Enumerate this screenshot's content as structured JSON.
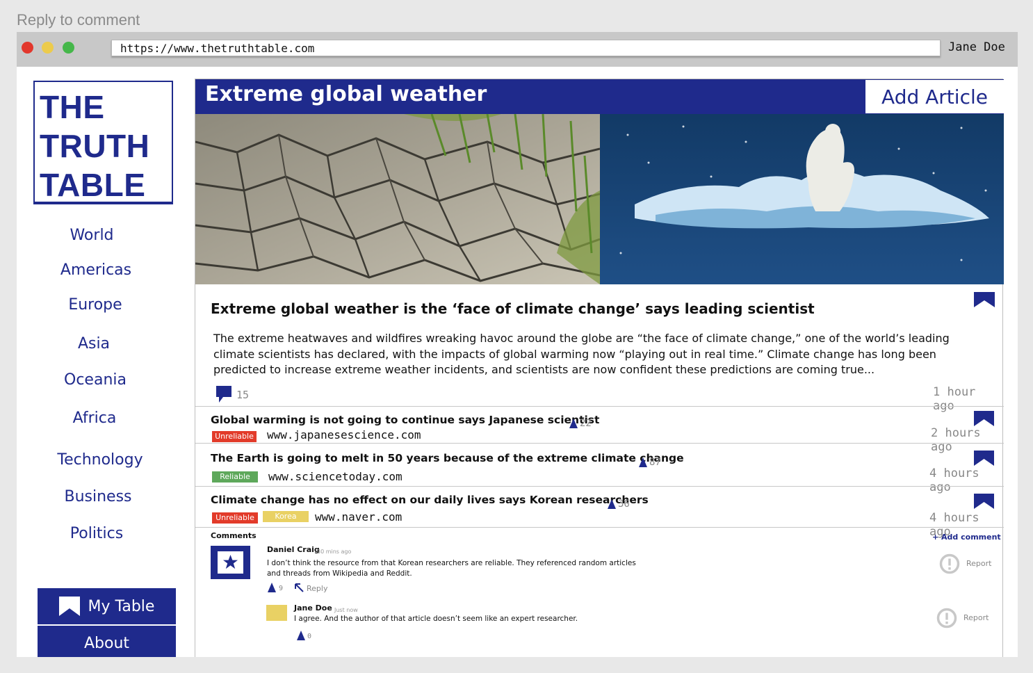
{
  "caption": "Reply to comment",
  "browser": {
    "url": "https://www.thetruthtable.com",
    "user": "Jane Doe"
  },
  "logo": {
    "line1": "THE",
    "line2": "TRUTH",
    "line3": "TABLE"
  },
  "nav": [
    "World",
    "Americas",
    "Europe",
    "Asia",
    "Oceania",
    "Africa",
    "Technology",
    "Business",
    "Politics"
  ],
  "sidebar_buttons": {
    "my_table": "My Table",
    "about": "About"
  },
  "header": {
    "title": "Extreme global weather",
    "add_article": "Add Article"
  },
  "main_article": {
    "title": "Extreme global weather is the ‘face of climate change’ says leading scientist",
    "body": "The extreme heatwaves and wildfires wreaking havoc around the globe are “the face of climate change,” one of the world’s leading climate scientists has declared, with the impacts of global warming now “playing out in real time.” Climate change has long been predicted to increase extreme weather incidents, and scientists are now confident these predictions are coming true...",
    "comment_count": "15",
    "time": "1 hour ago"
  },
  "related": [
    {
      "title": "Global warming is not going to continue says Japanese scientist",
      "badges": [
        "Unreliable"
      ],
      "source": "www.japanesescience.com",
      "votes": "22",
      "time": "2 hours ago"
    },
    {
      "title": "The Earth is going to melt in 50 years because of the extreme climate change",
      "badges": [
        "Reliable"
      ],
      "source": "www.sciencetoday.com",
      "votes": "87",
      "time": "4 hours ago"
    },
    {
      "title": "Climate change has no effect on our daily lives says Korean researchers",
      "badges": [
        "Unreliable",
        "Korea"
      ],
      "source": "www.naver.com",
      "votes": "36",
      "time": "4 hours ago"
    }
  ],
  "comments": {
    "label": "Comments",
    "add_label": "+ Add comment",
    "items": [
      {
        "author": "Daniel Craig",
        "time": "30 mins ago",
        "text_line1": "I don’t think the resource from that Korean researchers are reliable. They referenced random articles",
        "text_line2": "and threads from Wikipedia and Reddit.",
        "votes": "9",
        "reply_label": "Reply",
        "report_label": "Report"
      },
      {
        "author": "Jane Doe",
        "time": "Just now",
        "text_line1": "I agree. And the author of that article doesn’t seem like an expert researcher.",
        "votes": "0",
        "report_label": "Report"
      }
    ]
  },
  "colors": {
    "brand": "#1f2a8c",
    "unreliable": "#e23b2a",
    "reliable": "#5ea85b",
    "country_tag": "#e9d164"
  },
  "icons": {
    "bookmark": "bookmark-icon",
    "comment": "comment-icon",
    "upvote": "upvote-icon",
    "reply": "reply-arrow-icon",
    "report": "report-icon",
    "star": "star-icon"
  }
}
